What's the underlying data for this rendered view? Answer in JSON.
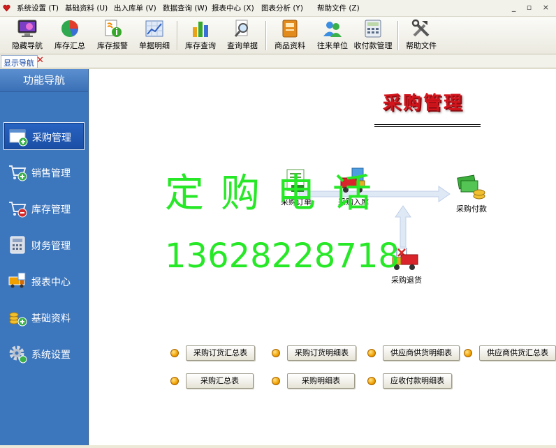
{
  "menubar": {
    "items": [
      "系统设置 (T)",
      "基础资料 (U)",
      "出入库单 (V)",
      "数据查询 (W)",
      "报表中心 (X)",
      "图表分析 (Y)",
      "帮助文件 (Z)"
    ],
    "window_controls": "_ ▫ ×"
  },
  "toolbar": {
    "items": [
      {
        "label": "隐藏导航",
        "icon": "monitor-icon"
      },
      {
        "label": "库存汇总",
        "icon": "pie-chart-icon"
      },
      {
        "label": "库存报警",
        "icon": "alert-document-icon"
      },
      {
        "label": "单据明细",
        "icon": "line-chart-icon"
      },
      {
        "label": "库存查询",
        "icon": "bar-chart-icon"
      },
      {
        "label": "查询单据",
        "icon": "magnifier-icon"
      },
      {
        "label": "商品资料",
        "icon": "book-icon"
      },
      {
        "label": "往来单位",
        "icon": "users-icon"
      },
      {
        "label": "收付款管理",
        "icon": "calculator-icon"
      },
      {
        "label": "帮助文件",
        "icon": "tools-icon"
      }
    ]
  },
  "tabs": {
    "nav_label": "显示导航",
    "close_label": "✕"
  },
  "sidebar": {
    "title": "功能导航",
    "items": [
      {
        "label": "采购管理",
        "icon": "purchase-icon",
        "active": true
      },
      {
        "label": "销售管理",
        "icon": "cart-add-icon",
        "active": false
      },
      {
        "label": "库存管理",
        "icon": "cart-remove-icon",
        "active": false
      },
      {
        "label": "财务管理",
        "icon": "calculator-icon",
        "active": false
      },
      {
        "label": "报表中心",
        "icon": "truck-report-icon",
        "active": false
      },
      {
        "label": "基础资料",
        "icon": "coins-icon",
        "active": false
      },
      {
        "label": "系统设置",
        "icon": "gear-icon",
        "active": false
      }
    ]
  },
  "main": {
    "title": "采购管理",
    "flow": {
      "order": "采购订单",
      "stock_in": "采购入库",
      "payment": "采购付款",
      "return": "采购退货"
    },
    "watermark": "定购电话",
    "phone": "13628228718",
    "reports": [
      "采购订货汇总表",
      "采购订货明细表",
      "供应商供货明细表",
      "供应商供货汇总表",
      "采购汇总表",
      "采购明细表",
      "应收付款明细表"
    ]
  },
  "colors": {
    "sidebar_bg": "#3c76bd",
    "title_red": "#d4141c",
    "watermark_green": "#27e827",
    "tab_close_red": "#d21111"
  }
}
